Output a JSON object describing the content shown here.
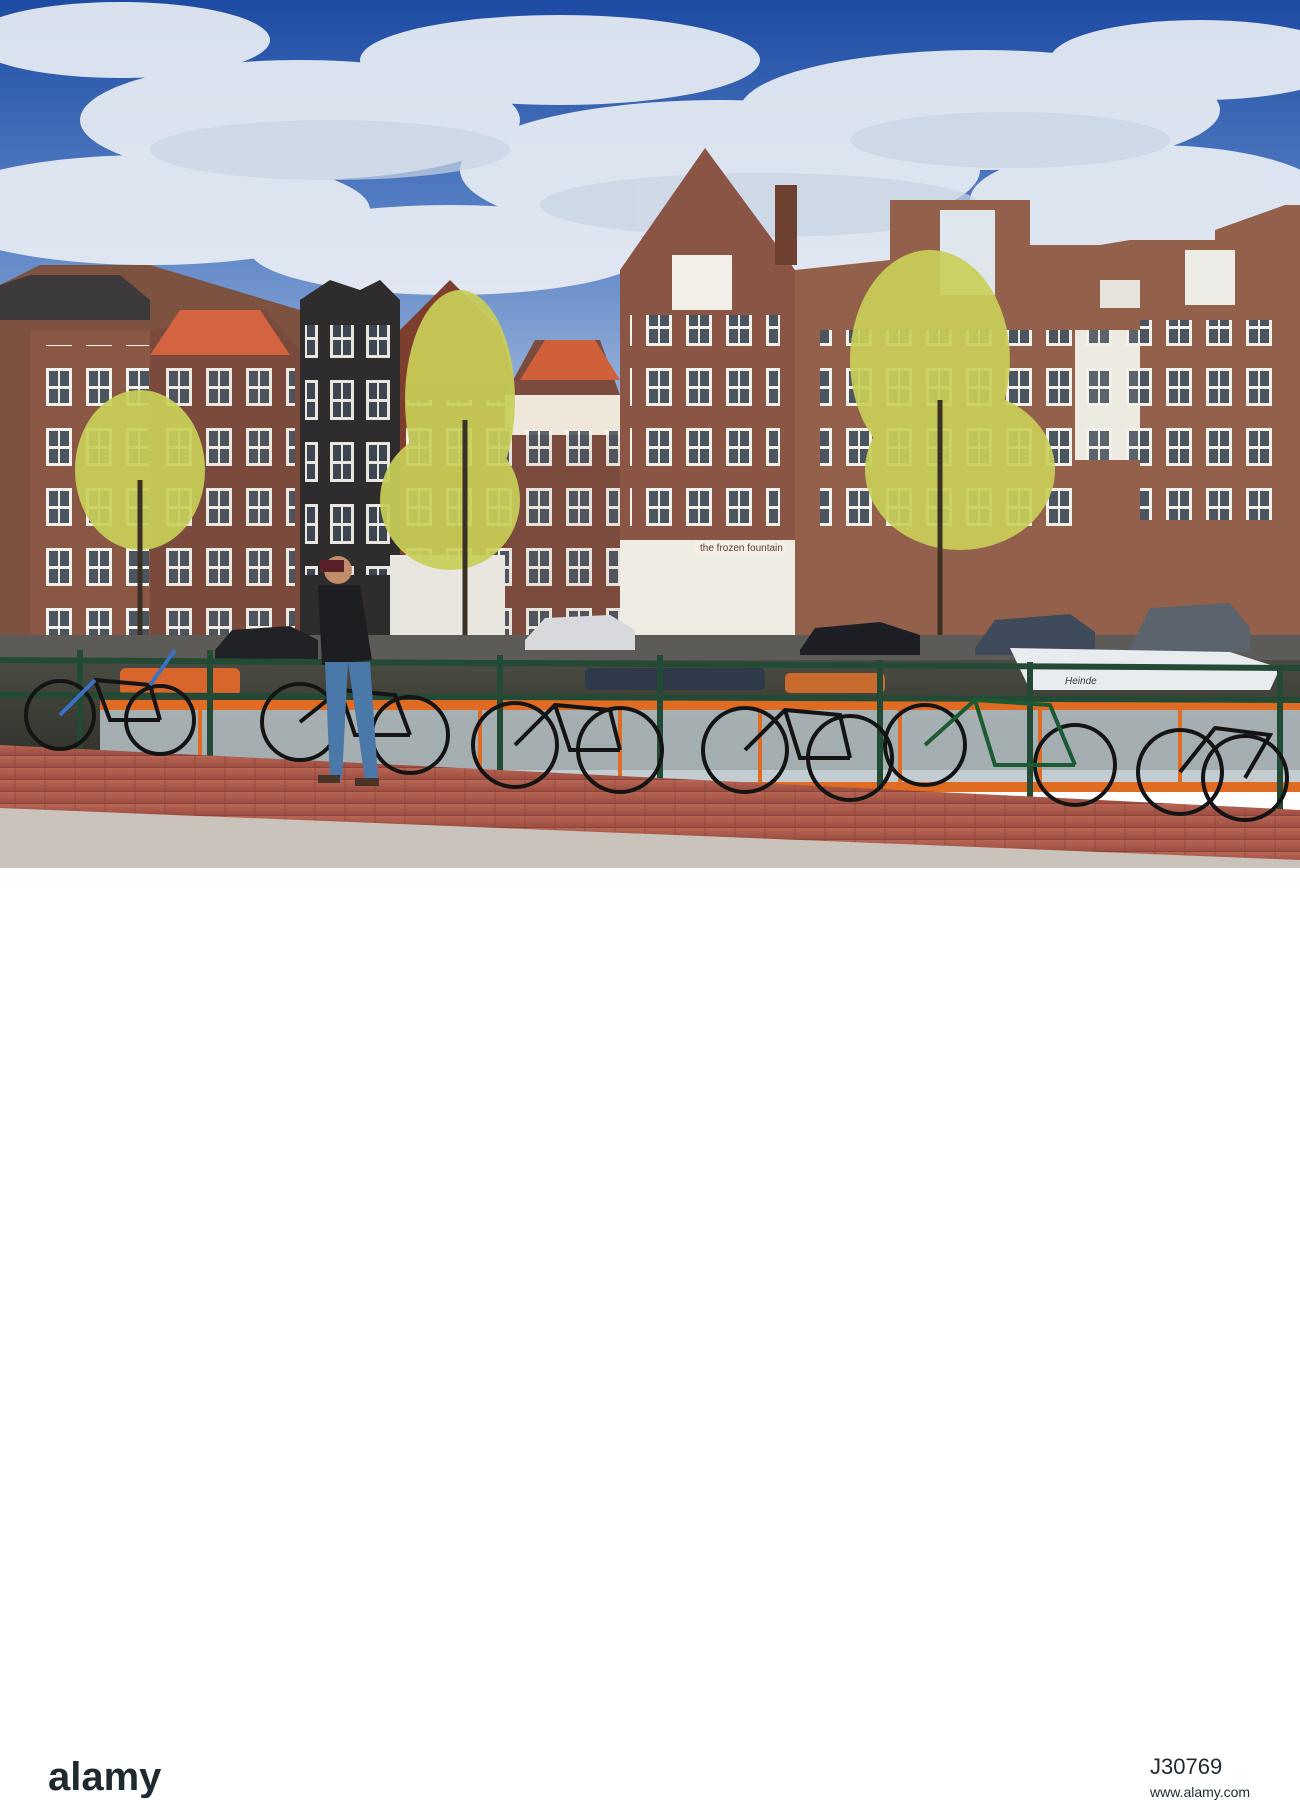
{
  "photo": {
    "shop_sign_left": "",
    "shop_sign_center": "the frozen fountain",
    "boat_name": "Heinde"
  },
  "watermark": {
    "logo_text": "alamy",
    "stock_id": "J30769",
    "url": "www.alamy.com"
  },
  "colors": {
    "sky_top": "#1f4fa8",
    "cloud": "#e6ecf3",
    "brick": "#8a5a45",
    "pavement": "#b6604f"
  }
}
